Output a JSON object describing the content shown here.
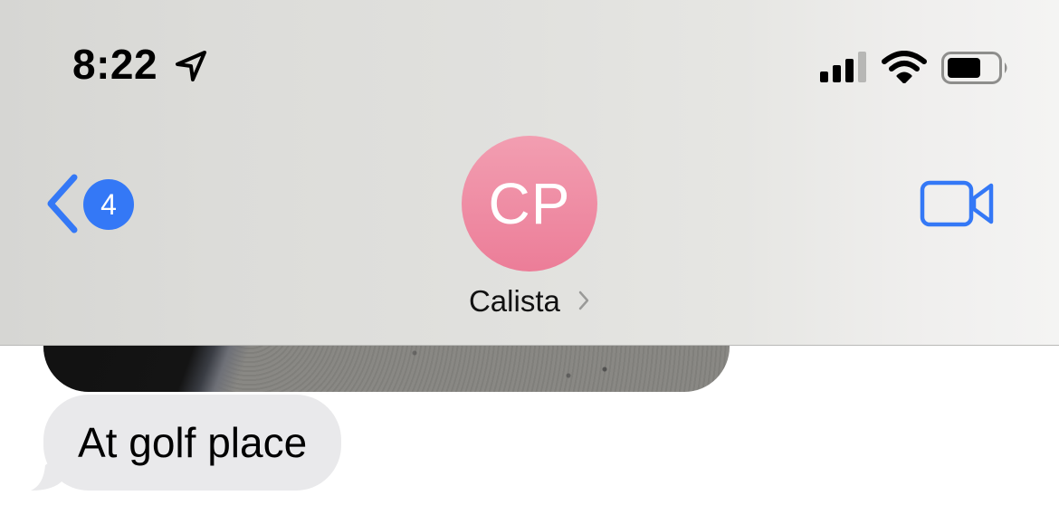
{
  "status_bar": {
    "time": "8:22",
    "icons": [
      "location-arrow-icon",
      "cellular-signal-icon",
      "wifi-icon",
      "battery-icon"
    ]
  },
  "nav": {
    "back_badge": "4",
    "contact_initials": "CP",
    "contact_name": "Calista",
    "icons": [
      "chevron-left-icon",
      "chevron-right-icon",
      "video-camera-icon"
    ]
  },
  "messages": [
    {
      "type": "image",
      "direction": "incoming"
    },
    {
      "type": "text",
      "direction": "incoming",
      "text": "At golf place"
    }
  ],
  "colors": {
    "accent": "#3478f6",
    "avatar_top": "#f29eb1",
    "avatar_bottom": "#ec7d98",
    "incoming_bubble": "#e9e9eb"
  }
}
